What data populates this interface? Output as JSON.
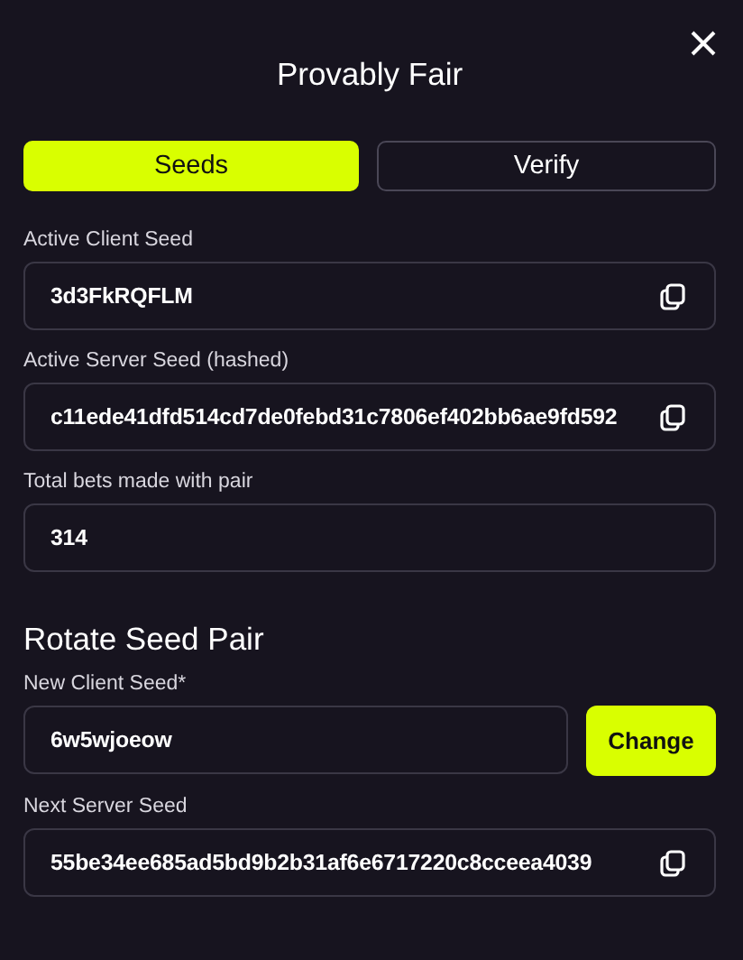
{
  "title": "Provably Fair",
  "tabs": [
    {
      "label": "Seeds",
      "selected": true
    },
    {
      "label": "Verify",
      "selected": false
    }
  ],
  "fields": [
    {
      "label": "Active Client Seed",
      "value": "3d3FkRQFLM",
      "kind": "copy"
    },
    {
      "label": "Active Server Seed (hashed)",
      "value": "c11ede41dfd514cd7de0febd31c7806ef402bb6ae9fd592",
      "kind": "copy"
    },
    {
      "label": "Total bets made with pair",
      "value": "314",
      "kind": "plain"
    }
  ],
  "rotate": {
    "heading": "Rotate Seed Pair",
    "fields": [
      {
        "label": "New Client Seed*",
        "value": "6w5wjoeow",
        "kind": "action",
        "button": "Change"
      },
      {
        "label": "Next Server Seed",
        "value": "55be34ee685ad5bd9b2b31af6e6717220c8cceea4039",
        "kind": "copy"
      }
    ]
  }
}
